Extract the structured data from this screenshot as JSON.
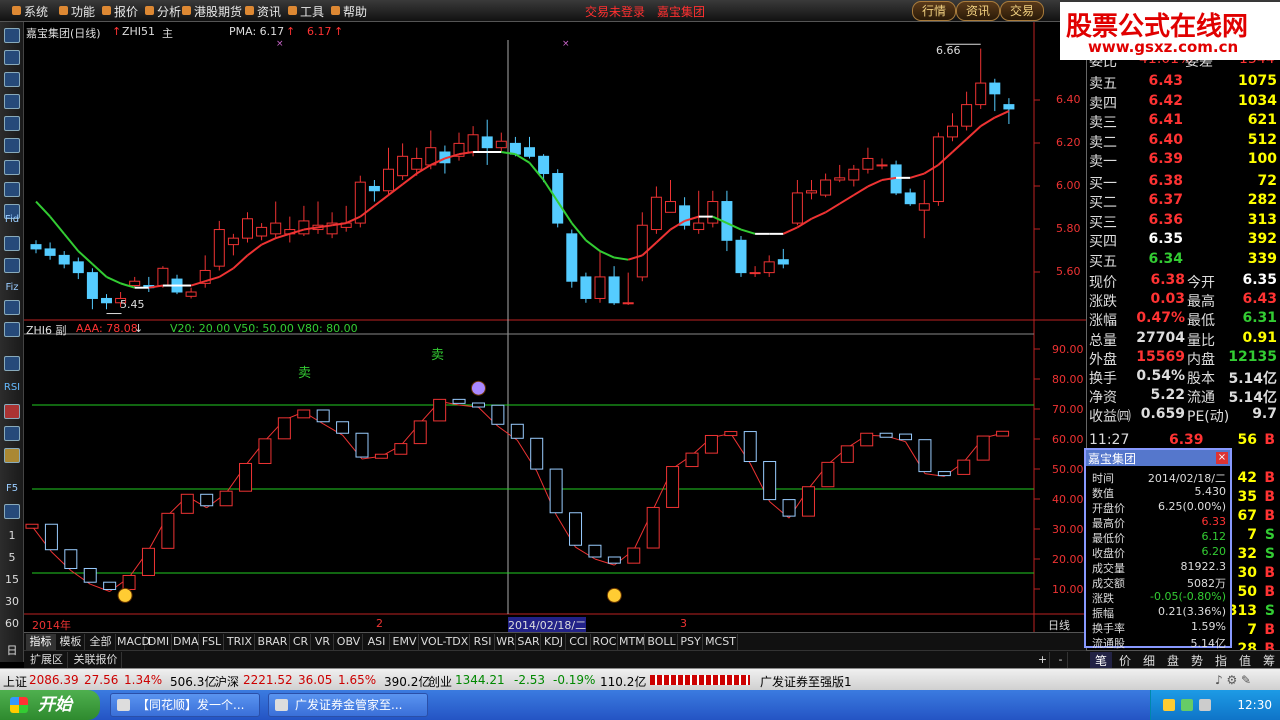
{
  "menu": {
    "items": [
      "系统",
      "功能",
      "报价",
      "分析",
      "港股期货",
      "资讯",
      "工具",
      "帮助"
    ],
    "status": "交易未登录　嘉宝集团",
    "right_buttons": [
      "行情",
      "资讯",
      "交易"
    ]
  },
  "watermark": {
    "title": "股票公式在线网",
    "url": "www.gsxz.com.cn"
  },
  "main_chart": {
    "title": "嘉宝集团(日线)",
    "indicator": "ZHI51",
    "mode": "主",
    "pma_label": "PMA: 6.17",
    "pma_value": "6.17",
    "price_high_label": "6.66",
    "price_low_label": "5.45",
    "y_ticks": [
      "6.40",
      "6.20",
      "6.00",
      "5.80",
      "5.60"
    ],
    "markers": [
      "×",
      "×"
    ]
  },
  "sub_chart": {
    "title": "ZHI6 副",
    "aaa_label": "AAA: 78.08",
    "levels_label": "V20: 20.00  V50: 50.00  V80: 80.00",
    "sell_marks": [
      "卖",
      "卖"
    ],
    "y_ticks": [
      "90.00",
      "80.00",
      "70.00",
      "60.00",
      "50.00",
      "40.00",
      "30.00",
      "20.00",
      "10.00"
    ]
  },
  "x_axis": {
    "start": "2014年",
    "m2": "2",
    "cursor_date": "2014/02/18/二",
    "m3": "3",
    "period": "日线",
    "plus": "+",
    "minus": "-"
  },
  "toolbar": {
    "labels": [
      "Fid",
      "Fiz",
      "F5",
      "RSI"
    ],
    "periods": [
      "1",
      "5",
      "15",
      "30",
      "60",
      "日"
    ]
  },
  "tabs": [
    "指标",
    "模板",
    "全部",
    "MACD",
    "DMI",
    "DMA",
    "FSL",
    "TRIX",
    "BRAR",
    "CR",
    "VR",
    "OBV",
    "ASI",
    "EMV",
    "VOL-TDX",
    "RSI",
    "WR",
    "SAR",
    "KDJ",
    "CCI",
    "ROC",
    "MTM",
    "BOLL",
    "PSY",
    "MCST"
  ],
  "ext_tabs": [
    "扩展区",
    "关联报价"
  ],
  "quote": {
    "header": {
      "left": "委比",
      "left_val": "41.01%",
      "right": "委差",
      "right_val": "1344"
    },
    "sells": [
      {
        "name": "卖五",
        "price": "6.43",
        "vol": "1075"
      },
      {
        "name": "卖四",
        "price": "6.42",
        "vol": "1034"
      },
      {
        "name": "卖三",
        "price": "6.41",
        "vol": "621"
      },
      {
        "name": "卖二",
        "price": "6.40",
        "vol": "512"
      },
      {
        "name": "卖一",
        "price": "6.39",
        "vol": "100"
      }
    ],
    "buys": [
      {
        "name": "买一",
        "price": "6.38",
        "vol": "72"
      },
      {
        "name": "买二",
        "price": "6.37",
        "vol": "282"
      },
      {
        "name": "买三",
        "price": "6.36",
        "vol": "313"
      },
      {
        "name": "买四",
        "price": "6.35",
        "vol": "392"
      },
      {
        "name": "买五",
        "price": "6.34",
        "vol": "339"
      }
    ],
    "fields": [
      {
        "k1": "现价",
        "v1": "6.38",
        "k2": "今开",
        "v2": "6.35"
      },
      {
        "k1": "涨跌",
        "v1": "0.03",
        "k2": "最高",
        "v2": "6.43"
      },
      {
        "k1": "涨幅",
        "v1": "0.47%",
        "k2": "最低",
        "v2": "6.31"
      },
      {
        "k1": "总量",
        "v1": "27704",
        "k2": "量比",
        "v2": "0.91"
      },
      {
        "k1": "外盘",
        "v1": "15569",
        "k2": "内盘",
        "v2": "12135"
      },
      {
        "k1": "换手",
        "v1": "0.54%",
        "k2": "股本",
        "v2": "5.14亿"
      },
      {
        "k1": "净资",
        "v1": "5.22",
        "k2": "流通",
        "v2": "5.14亿"
      },
      {
        "k1": "收益㈣",
        "v1": "0.659",
        "k2": "PE(动)",
        "v2": "9.7"
      }
    ],
    "ticks": [
      {
        "time": "11:27",
        "price": "6.39",
        "vol": "56",
        "dir": "B"
      },
      {
        "time": "",
        "price": "",
        "vol": "",
        "dir": ""
      },
      {
        "time": "",
        "price": "",
        "vol": "42",
        "dir": "B"
      },
      {
        "time": "",
        "price": "",
        "vol": "35",
        "dir": "B"
      },
      {
        "time": "",
        "price": "",
        "vol": "67",
        "dir": "B"
      },
      {
        "time": "",
        "price": "",
        "vol": "7",
        "dir": "S"
      },
      {
        "time": "",
        "price": "",
        "vol": "32",
        "dir": "S"
      },
      {
        "time": "",
        "price": "",
        "vol": "30",
        "dir": "B"
      },
      {
        "time": "",
        "price": "",
        "vol": "50",
        "dir": "B"
      },
      {
        "time": "",
        "price": "",
        "vol": "313",
        "dir": "S"
      },
      {
        "time": "",
        "price": "",
        "vol": "7",
        "dir": "B"
      },
      {
        "time": "",
        "price": "",
        "vol": "28",
        "dir": "B"
      }
    ]
  },
  "info_popup": {
    "title": "嘉宝集团",
    "close": "×",
    "rows": [
      {
        "k": "时间",
        "v": "2014/02/18/二"
      },
      {
        "k": "数值",
        "v": "5.430"
      },
      {
        "k": "开盘价",
        "v": "6.25(0.00%)"
      },
      {
        "k": "最高价",
        "v": "6.33"
      },
      {
        "k": "最低价",
        "v": "6.12"
      },
      {
        "k": "收盘价",
        "v": "6.20"
      },
      {
        "k": "成交量",
        "v": "81922.3"
      },
      {
        "k": "成交额",
        "v": "5082万"
      },
      {
        "k": "涨跌",
        "v": "-0.05(-0.80%)"
      },
      {
        "k": "振幅",
        "v": "0.21(3.36%)"
      },
      {
        "k": "换手率",
        "v": "1.59%"
      },
      {
        "k": "流通股",
        "v": "5.14亿"
      }
    ]
  },
  "sidebar_tabs": [
    "笔",
    "价",
    "细",
    "盘",
    "势",
    "指",
    "值",
    "筹"
  ],
  "statusbar": {
    "sh": "上证",
    "sh_val": "2086.39",
    "sh_chg": "27.56",
    "sh_pct": "1.34%",
    "sh_amt": "506.3亿",
    "sz": "沪深",
    "sz_val": "2221.52",
    "sz_chg": "36.05",
    "sz_pct": "1.65%",
    "sz_amt": "390.2亿",
    "cy": "创业",
    "cy_val": "1344.21",
    "cy_chg": "-2.53",
    "cy_pct": "-0.19%",
    "cy_amt": "110.2亿",
    "broker": "广发证券至强版1"
  },
  "taskbar": {
    "start": "开始",
    "tasks": [
      "【同花顺】发一个...",
      "广发证券金管家至..."
    ],
    "clock": "12:30"
  },
  "chart_data": [
    {
      "type": "candlestick",
      "title": "嘉宝集团(日线)",
      "ylim": [
        5.4,
        6.7
      ],
      "candles": [
        [
          5.75,
          5.73,
          5.77,
          5.71
        ],
        [
          5.73,
          5.7,
          5.76,
          5.68
        ],
        [
          5.7,
          5.66,
          5.72,
          5.64
        ],
        [
          5.67,
          5.62,
          5.69,
          5.59
        ],
        [
          5.62,
          5.5,
          5.64,
          5.45
        ],
        [
          5.5,
          5.48,
          5.52,
          5.45
        ],
        [
          5.48,
          5.5,
          5.53,
          5.46
        ],
        [
          5.56,
          5.58,
          5.6,
          5.55
        ],
        [
          5.56,
          5.55,
          5.6,
          5.53
        ],
        [
          5.56,
          5.64,
          5.65,
          5.55
        ],
        [
          5.59,
          5.53,
          5.61,
          5.52
        ],
        [
          5.51,
          5.53,
          5.55,
          5.5
        ],
        [
          5.57,
          5.63,
          5.7,
          5.55
        ],
        [
          5.65,
          5.82,
          5.86,
          5.63
        ],
        [
          5.75,
          5.78,
          5.8,
          5.7
        ],
        [
          5.78,
          5.87,
          5.9,
          5.76
        ],
        [
          5.79,
          5.83,
          5.85,
          5.77
        ],
        [
          5.8,
          5.85,
          5.95,
          5.78
        ],
        [
          5.8,
          5.82,
          5.88,
          5.76
        ],
        [
          5.8,
          5.86,
          5.93,
          5.79
        ],
        [
          5.82,
          5.84,
          5.95,
          5.8
        ],
        [
          5.8,
          5.85,
          5.9,
          5.78
        ],
        [
          5.83,
          5.85,
          5.93,
          5.81
        ],
        [
          5.85,
          6.04,
          6.07,
          5.83
        ],
        [
          6.02,
          6.0,
          6.05,
          5.95
        ],
        [
          6.0,
          6.1,
          6.2,
          5.98
        ],
        [
          6.07,
          6.16,
          6.22,
          6.05
        ],
        [
          6.1,
          6.15,
          6.2,
          6.07
        ],
        [
          6.12,
          6.2,
          6.28,
          6.1
        ],
        [
          6.18,
          6.13,
          6.21,
          6.08
        ],
        [
          6.16,
          6.22,
          6.27,
          6.14
        ],
        [
          6.18,
          6.26,
          6.3,
          6.16
        ],
        [
          6.25,
          6.2,
          6.33,
          6.12
        ],
        [
          6.2,
          6.23,
          6.27,
          6.18
        ],
        [
          6.22,
          6.17,
          6.25,
          6.16
        ],
        [
          6.2,
          6.16,
          6.25,
          6.15
        ],
        [
          6.16,
          6.08,
          6.17,
          6.04
        ],
        [
          6.08,
          5.85,
          6.1,
          5.83
        ],
        [
          5.8,
          5.58,
          5.82,
          5.55
        ],
        [
          5.6,
          5.5,
          5.62,
          5.48
        ],
        [
          5.5,
          5.6,
          5.72,
          5.48
        ],
        [
          5.6,
          5.48,
          5.65,
          5.47
        ],
        [
          5.48,
          5.48,
          5.62,
          5.47
        ],
        [
          5.6,
          5.84,
          5.9,
          5.58
        ],
        [
          5.82,
          5.97,
          6.02,
          5.8
        ],
        [
          5.9,
          5.95,
          6.05,
          5.9
        ],
        [
          5.93,
          5.84,
          5.97,
          5.82
        ],
        [
          5.82,
          5.85,
          6.0,
          5.8
        ],
        [
          5.85,
          5.95,
          6.0,
          5.83
        ],
        [
          5.95,
          5.77,
          6.0,
          5.72
        ],
        [
          5.77,
          5.62,
          5.79,
          5.6
        ],
        [
          5.62,
          5.62,
          5.65,
          5.6
        ],
        [
          5.62,
          5.67,
          5.7,
          5.6
        ],
        [
          5.68,
          5.66,
          5.73,
          5.64
        ],
        [
          5.85,
          5.99,
          6.05,
          5.84
        ],
        [
          5.99,
          6.0,
          6.05,
          5.96
        ],
        [
          5.98,
          6.05,
          6.08,
          5.97
        ],
        [
          6.05,
          6.06,
          6.12,
          6.04
        ],
        [
          6.05,
          6.1,
          6.12,
          6.02
        ],
        [
          6.1,
          6.15,
          6.2,
          6.08
        ],
        [
          6.12,
          6.12,
          6.15,
          6.1
        ],
        [
          6.12,
          5.99,
          6.14,
          5.98
        ],
        [
          5.99,
          5.94,
          6.01,
          5.93
        ],
        [
          5.91,
          5.94,
          6.05,
          5.78
        ],
        [
          5.95,
          6.25,
          6.27,
          5.93
        ],
        [
          6.25,
          6.3,
          6.36,
          6.23
        ],
        [
          6.3,
          6.4,
          6.46,
          6.28
        ],
        [
          6.4,
          6.5,
          6.66,
          6.38
        ],
        [
          6.5,
          6.45,
          6.52,
          6.37
        ],
        [
          6.4,
          6.38,
          6.43,
          6.31
        ]
      ],
      "pma_points": [
        5.95,
        5.88,
        5.8,
        5.72,
        5.66,
        5.6,
        5.57,
        5.55,
        5.55,
        5.56,
        5.56,
        5.56,
        5.58,
        5.6,
        5.64,
        5.7,
        5.75,
        5.78,
        5.8,
        5.82,
        5.83,
        5.84,
        5.85,
        5.88,
        5.93,
        5.98,
        6.03,
        6.08,
        6.12,
        6.15,
        6.17,
        6.18,
        6.18,
        6.18,
        6.17,
        6.13,
        6.05,
        5.95,
        5.85,
        5.77,
        5.72,
        5.69,
        5.68,
        5.7,
        5.76,
        5.82,
        5.86,
        5.88,
        5.88,
        5.85,
        5.82,
        5.8,
        5.8,
        5.8,
        5.83,
        5.87,
        5.9,
        5.94,
        5.98,
        6.02,
        6.05,
        6.06,
        6.06,
        6.08,
        6.12,
        6.18,
        6.24,
        6.3,
        6.34,
        6.37
      ]
    },
    {
      "type": "line",
      "title": "ZHI6",
      "ylim": [
        0,
        100
      ],
      "levels": [
        20,
        50,
        80
      ],
      "values": [
        36.7,
        27.6,
        20.9,
        16,
        13.4,
        18.4,
        28.1,
        40.6,
        47.4,
        43.3,
        48.5,
        58.4,
        67.2,
        74.7,
        77.5,
        73.3,
        69.2,
        60.7,
        61.7,
        65.5,
        73.6,
        81.3,
        80.0,
        79.2,
        72.4,
        67.4,
        56.4,
        40.8,
        29.2,
        25,
        22.8,
        28.2,
        42.7,
        57.3,
        62.1,
        68.4,
        69.8,
        59.1,
        45.5,
        39.6,
        50.1,
        58.8,
        64.7,
        69.2,
        68.9,
        66.9,
        55.5,
        54.5,
        59.6,
        68.2,
        69.9
      ]
    }
  ]
}
